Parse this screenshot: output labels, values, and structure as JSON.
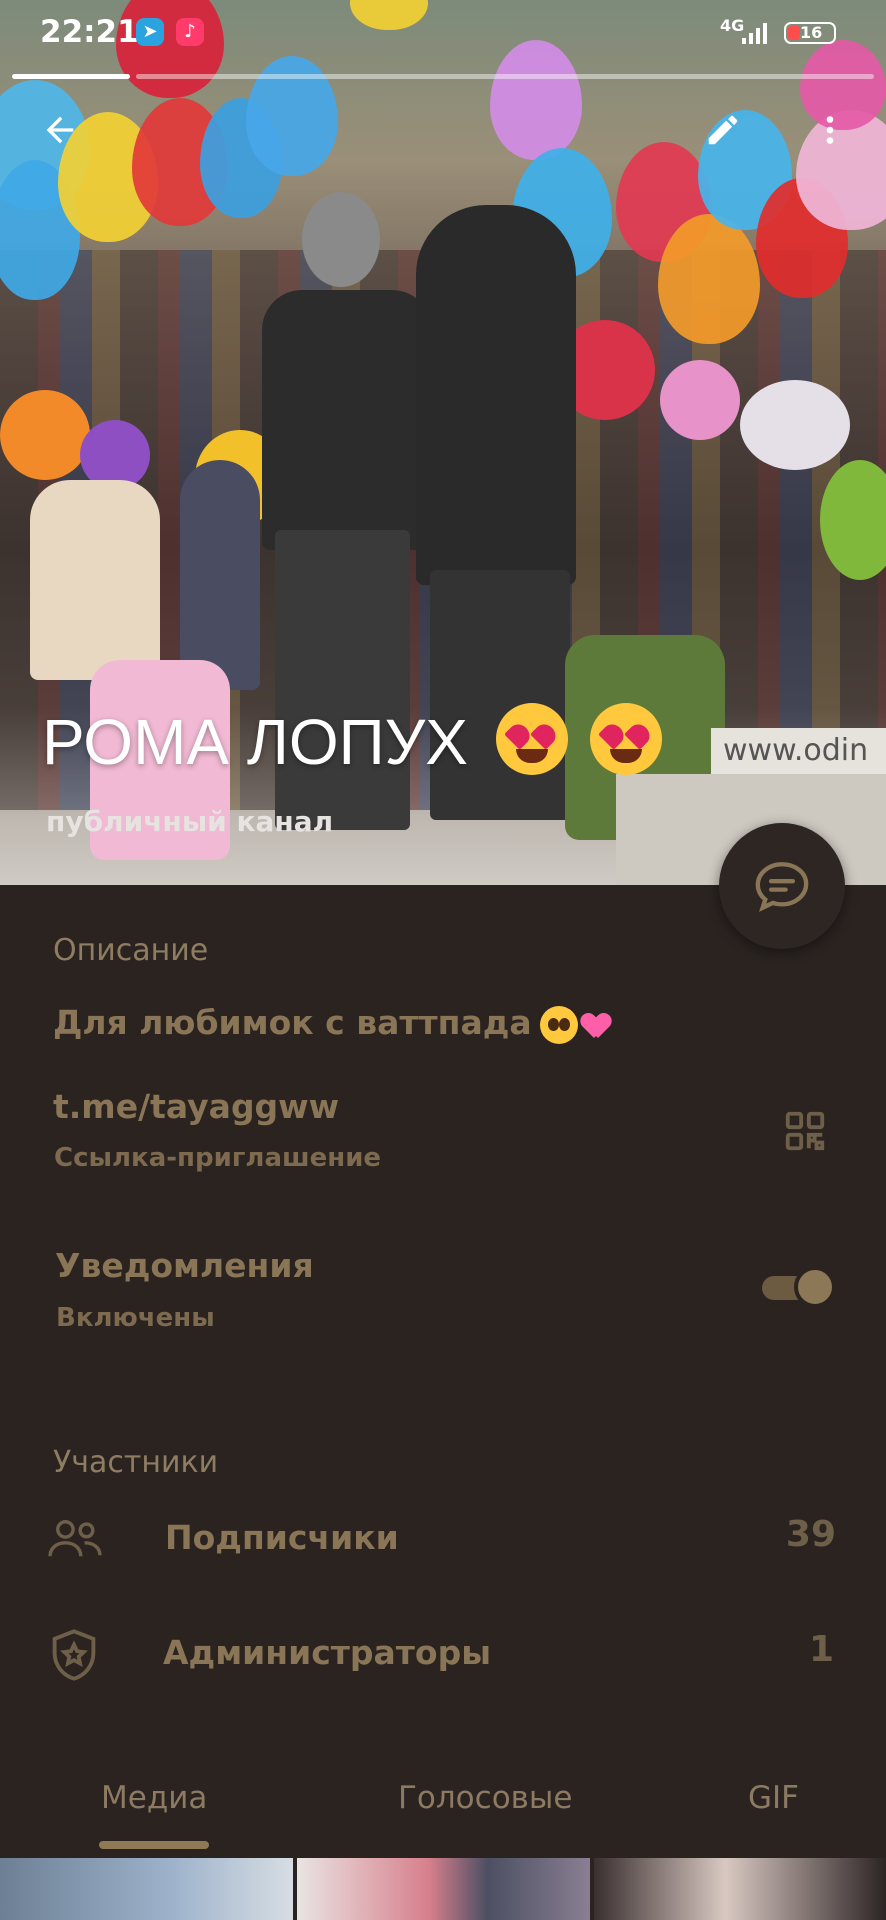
{
  "status_bar": {
    "time": "22:21",
    "network": "4G",
    "battery": "16"
  },
  "header": {
    "title": "РОМА ЛОПУХ",
    "subtitle": "публичный канал",
    "banner_text": "www.odin"
  },
  "info": {
    "description_label": "Описание",
    "description": "Для любимок с ваттпада",
    "link": "t.me/tayaggww",
    "link_label": "Ссылка-приглашение",
    "notifications_title": "Уведомления",
    "notifications_state": "Включены",
    "notifications_on": true
  },
  "members": {
    "section_label": "Участники",
    "rows": [
      {
        "label": "Подписчики",
        "count": "39",
        "icon": "people-icon"
      },
      {
        "label": "Администраторы",
        "count": "1",
        "icon": "admin-shield-icon"
      }
    ]
  },
  "tabs": [
    {
      "label": "Медиа",
      "active": true
    },
    {
      "label": "Голосовые",
      "active": false
    },
    {
      "label": "GIF",
      "active": false
    }
  ],
  "colors": {
    "background": "#2a2320",
    "accent_text": "#8a7656",
    "label_text": "#8f7d62"
  }
}
